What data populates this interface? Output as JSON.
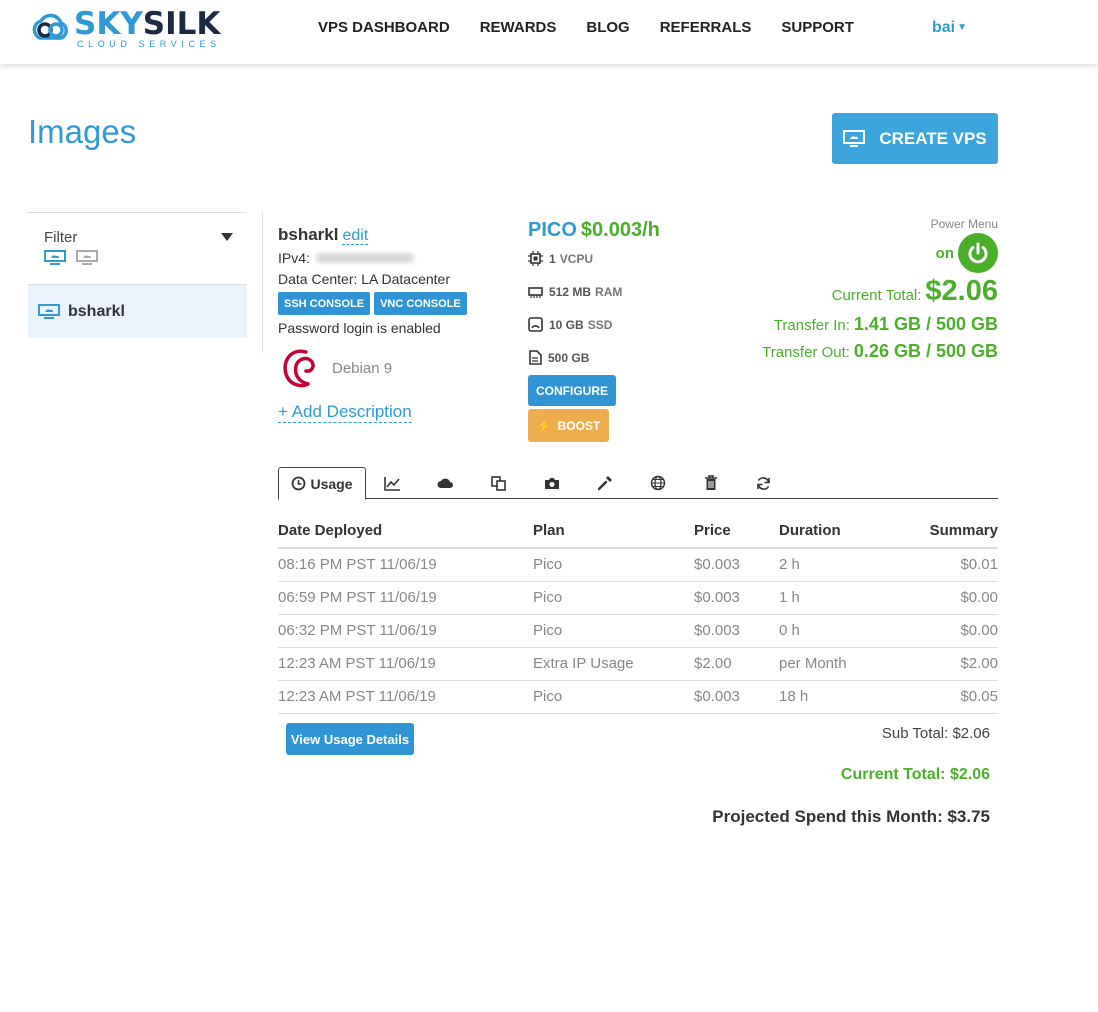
{
  "brand": {
    "name_part1": "SKY",
    "name_part2": "SILK",
    "tagline": "CLOUD SERVICES",
    "accent": "#2f9ad6",
    "dark": "#1d2a44"
  },
  "nav": {
    "items": [
      "VPS DASHBOARD",
      "REWARDS",
      "BLOG",
      "REFERRALS",
      "SUPPORT"
    ],
    "user": "bai"
  },
  "page": {
    "title": "Images",
    "create_label": "CREATE VPS"
  },
  "sidebar": {
    "filter_label": "Filter",
    "items": [
      {
        "label": "bsharkl"
      }
    ]
  },
  "server": {
    "name": "bsharkl",
    "edit_label": "edit",
    "ipv4_label": "IPv4:",
    "datacenter": "Data Center: LA Datacenter",
    "ssh_label": "SSH CONSOLE",
    "vnc_label": "VNC CONSOLE",
    "password_note": "Password login is enabled",
    "os": "Debian 9",
    "add_description": "+ Add Description"
  },
  "plan": {
    "name": "PICO",
    "price": "$0.003/h",
    "specs": [
      {
        "value": "1",
        "unit": "VCPU",
        "icon": "cpu-icon"
      },
      {
        "value": "512 MB",
        "unit": "RAM",
        "icon": "ram-icon"
      },
      {
        "value": "10 GB",
        "unit": "SSD",
        "icon": "ssd-icon"
      },
      {
        "value": "500 GB",
        "unit": "",
        "icon": "file-icon"
      }
    ],
    "configure_label": "CONFIGURE",
    "boost_label": "BOOST"
  },
  "status": {
    "power_menu_label": "Power Menu",
    "power_state": "on",
    "current_total_label": "Current Total:",
    "current_total_value": "$2.06",
    "transfer_in_label": "Transfer In:",
    "transfer_in_value": "1.41 GB / 500 GB",
    "transfer_out_label": "Transfer Out:",
    "transfer_out_value": "0.26 GB / 500 GB",
    "green": "#4caf2a"
  },
  "tabs": {
    "active_label": "Usage",
    "icons": [
      "graph-icon",
      "cloud-icon",
      "copy-icon",
      "camera-icon",
      "tool-icon",
      "globe-icon",
      "trash-icon",
      "refresh-icon"
    ]
  },
  "usage": {
    "headers": [
      "Date Deployed",
      "Plan",
      "Price",
      "Duration",
      "Summary"
    ],
    "rows": [
      [
        "08:16 PM PST 11/06/19",
        "Pico",
        "$0.003",
        "2 h",
        "$0.01"
      ],
      [
        "06:59 PM PST 11/06/19",
        "Pico",
        "$0.003",
        "1 h",
        "$0.00"
      ],
      [
        "06:32 PM PST 11/06/19",
        "Pico",
        "$0.003",
        "0 h",
        "$0.00"
      ],
      [
        "12:23 AM PST 11/06/19",
        "Extra IP Usage",
        "$2.00",
        "per Month",
        "$2.00"
      ],
      [
        "12:23 AM PST 11/06/19",
        "Pico",
        "$0.003",
        "18 h",
        "$0.05"
      ]
    ],
    "view_details_label": "View Usage Details",
    "sub_total": "Sub Total: $2.06",
    "current_total": "Current Total: $2.06",
    "projected": "Projected Spend this Month: $3.75"
  }
}
